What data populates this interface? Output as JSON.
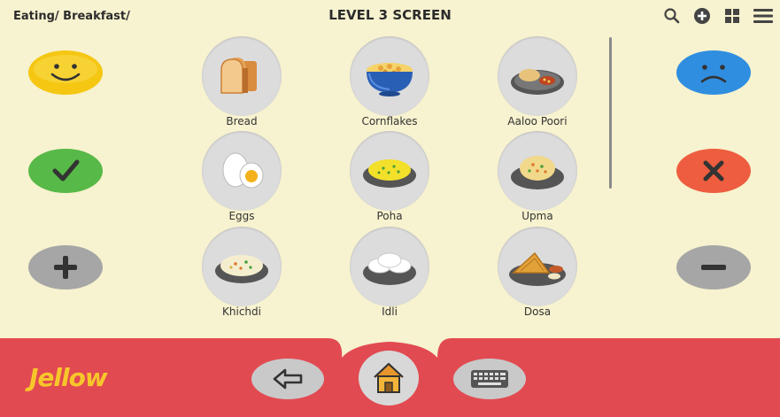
{
  "header": {
    "breadcrumb": "Eating/ Breakfast/",
    "title": "LEVEL 3 SCREEN"
  },
  "top_icons": [
    "search-icon",
    "add-circle-icon",
    "grid-icon",
    "menu-icon"
  ],
  "left_buttons": [
    "happy-face-icon",
    "check-icon",
    "plus-icon"
  ],
  "right_buttons": [
    "sad-face-icon",
    "cross-icon",
    "minus-icon"
  ],
  "grid": {
    "items": [
      {
        "label": "Bread"
      },
      {
        "label": "Cornflakes"
      },
      {
        "label": "Aaloo Poori"
      },
      {
        "label": "Eggs"
      },
      {
        "label": "Poha"
      },
      {
        "label": "Upma"
      },
      {
        "label": "Khichdi"
      },
      {
        "label": "Idli"
      },
      {
        "label": "Dosa"
      }
    ]
  },
  "footer": {
    "logo": "Jellow",
    "buttons": [
      "back-arrow-icon",
      "home-icon",
      "keyboard-icon"
    ]
  },
  "colors": {
    "background": "#f7f2cf",
    "footer": "#e24a51",
    "happy": "#f5c713",
    "check": "#57b947",
    "sad": "#2f8ee0",
    "cross": "#ee5d3f",
    "neutral": "#a6a6a6"
  }
}
